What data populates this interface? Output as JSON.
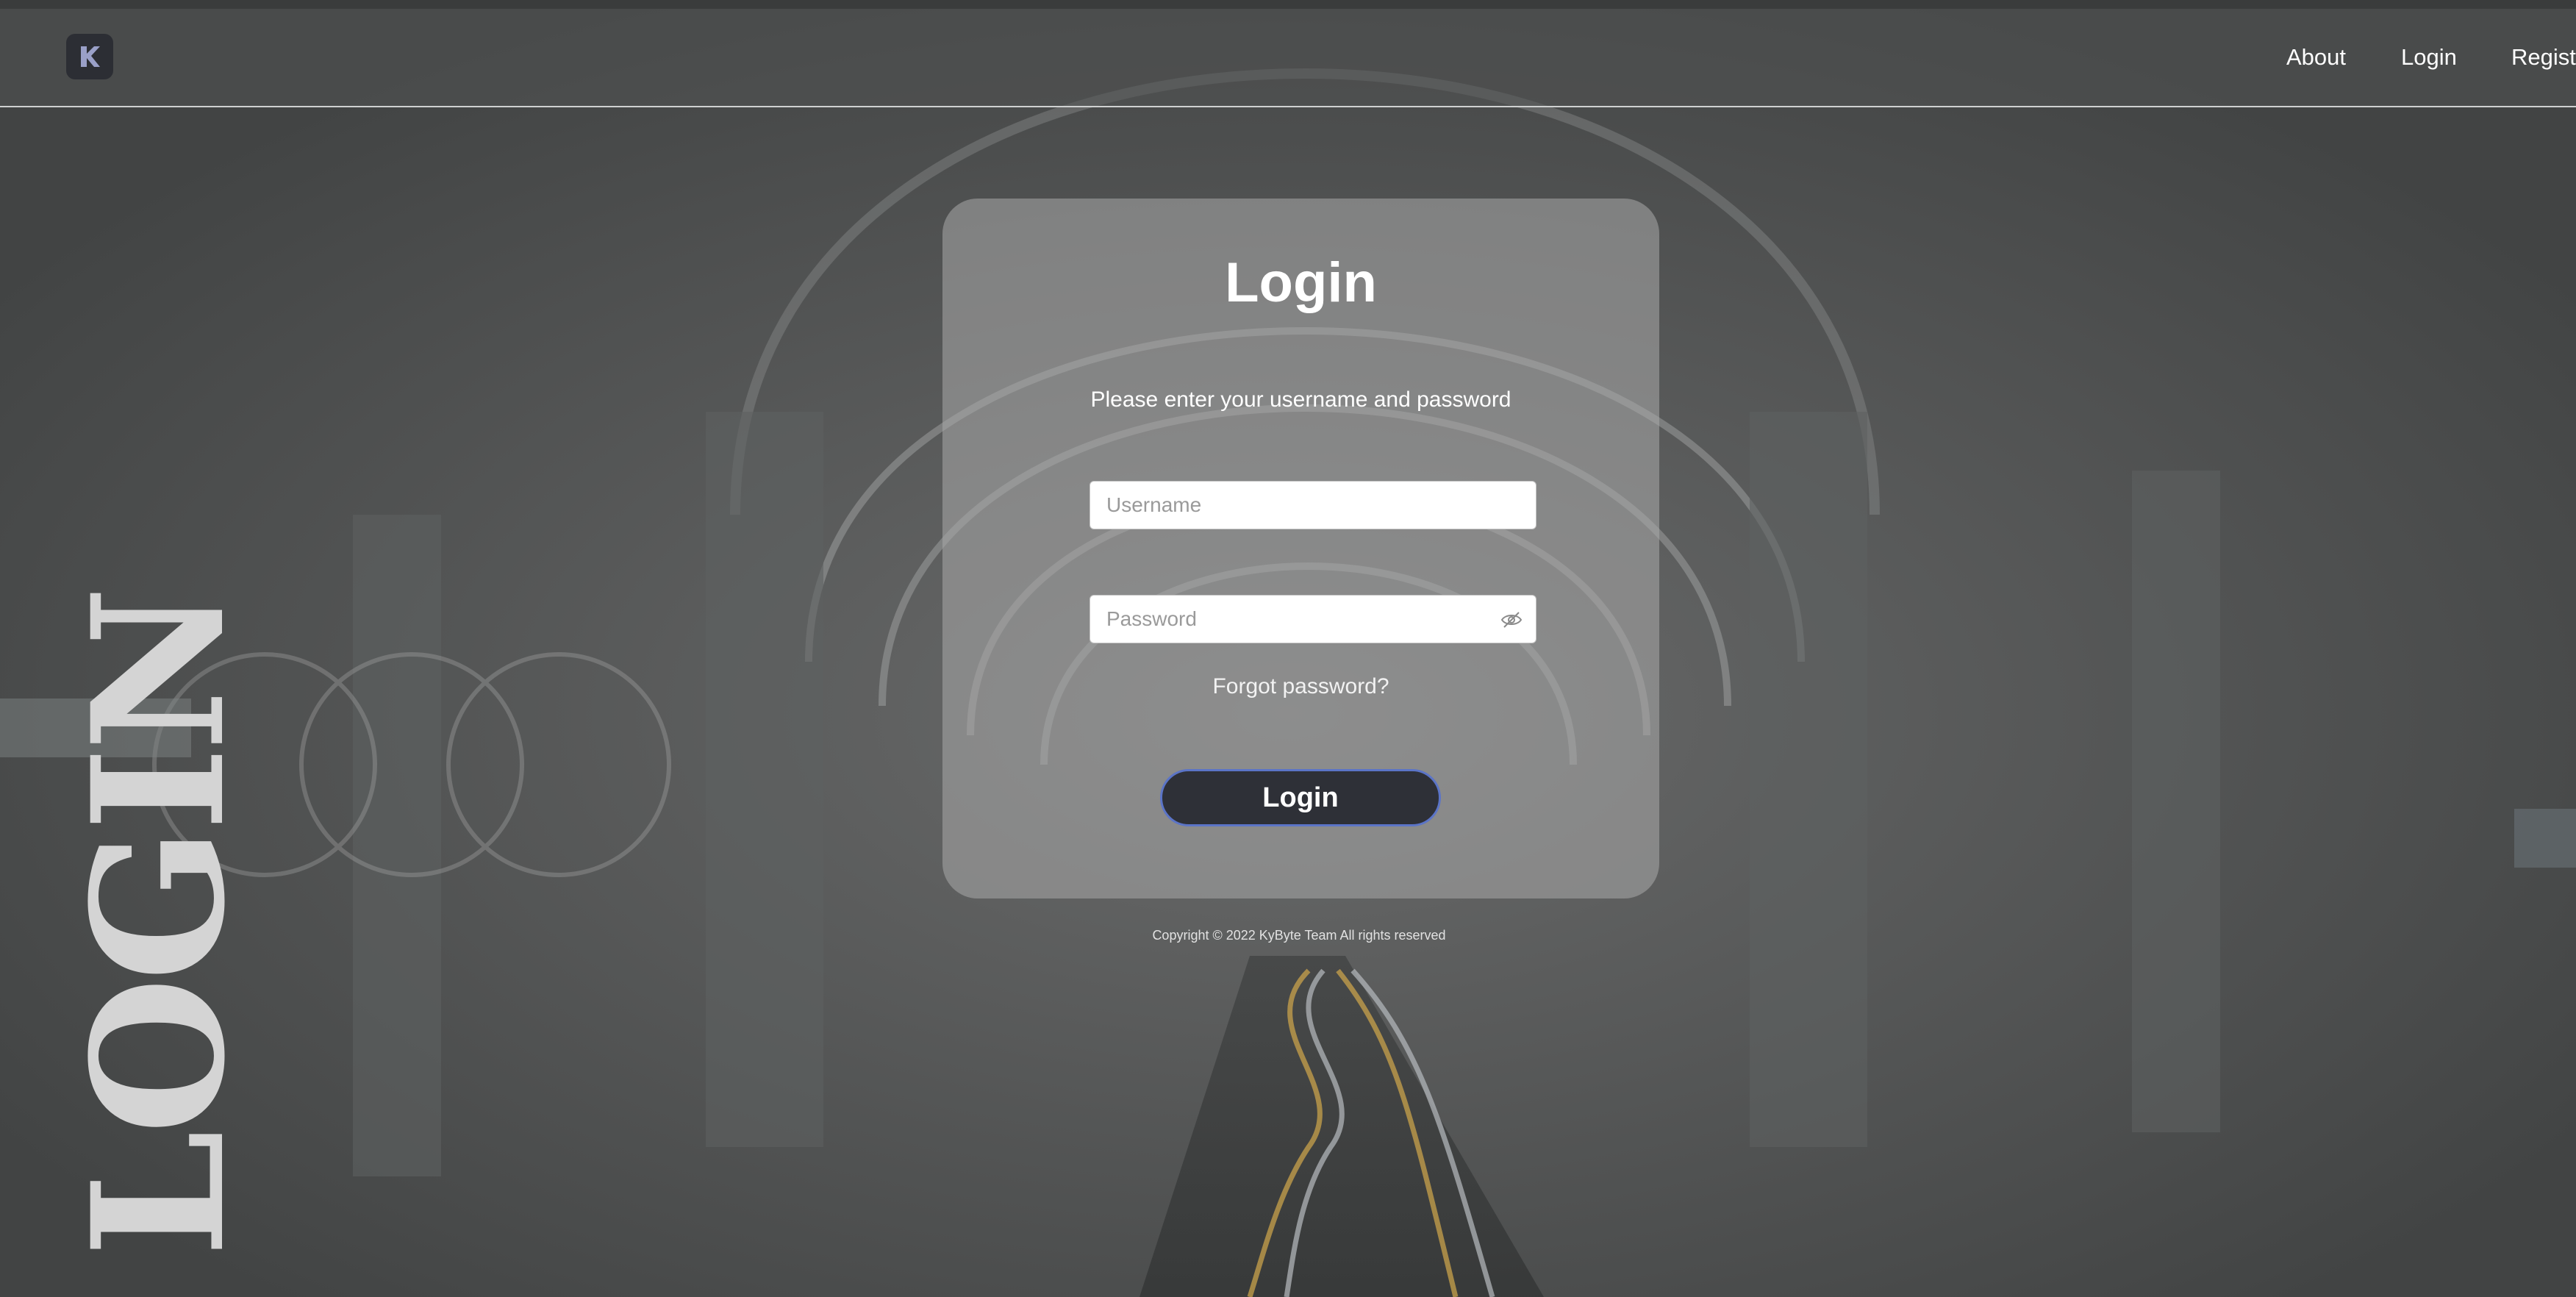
{
  "navbar": {
    "logo_icon": "app-logo-icon",
    "links": [
      "About",
      "Login",
      "Registe"
    ]
  },
  "hero": {
    "vertical_title": "LOGIN"
  },
  "login_card": {
    "title": "Login",
    "instructions": "Please enter your username and password",
    "username_placeholder": "Username",
    "password_placeholder": "Password",
    "password_toggle_icon": "eye-slash-icon",
    "forgot_link": "Forgot password?",
    "submit_label": "Login"
  },
  "footer": {
    "copyright": "Copyright © 2022 KyByte Team All rights reserved"
  },
  "colors": {
    "button_bg": "#2e3037",
    "button_border": "#5b74c7",
    "card_bg": "#aaaaaa",
    "page_bg": "#4a4c4c"
  }
}
